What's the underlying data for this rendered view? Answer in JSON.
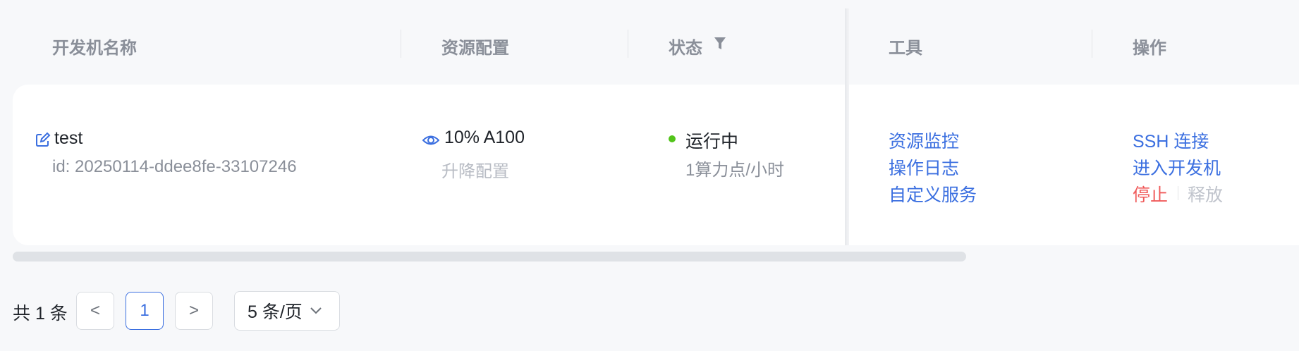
{
  "columns": {
    "name": "开发机名称",
    "resource": "资源配置",
    "status": "状态",
    "tools": "工具",
    "actions": "操作"
  },
  "row": {
    "name": "test",
    "id": "id: 20250114-ddee8fe-33107246",
    "resource": "10% A100",
    "upgrade": "升降配置",
    "status": "运行中",
    "price": "1算力点/小时",
    "tools": {
      "monitor": "资源监控",
      "log": "操作日志",
      "custom": "自定义服务"
    },
    "actions": {
      "ssh": "SSH 连接",
      "enter": "进入开发机",
      "stop": "停止",
      "release": "释放"
    }
  },
  "pagination": {
    "total": "共 1 条",
    "prev": "<",
    "current": "1",
    "next": ">",
    "page_size": "5 条/页"
  },
  "colors": {
    "link": "#3b6fe0",
    "danger": "#f05a5a",
    "status_running": "#52c41a"
  }
}
